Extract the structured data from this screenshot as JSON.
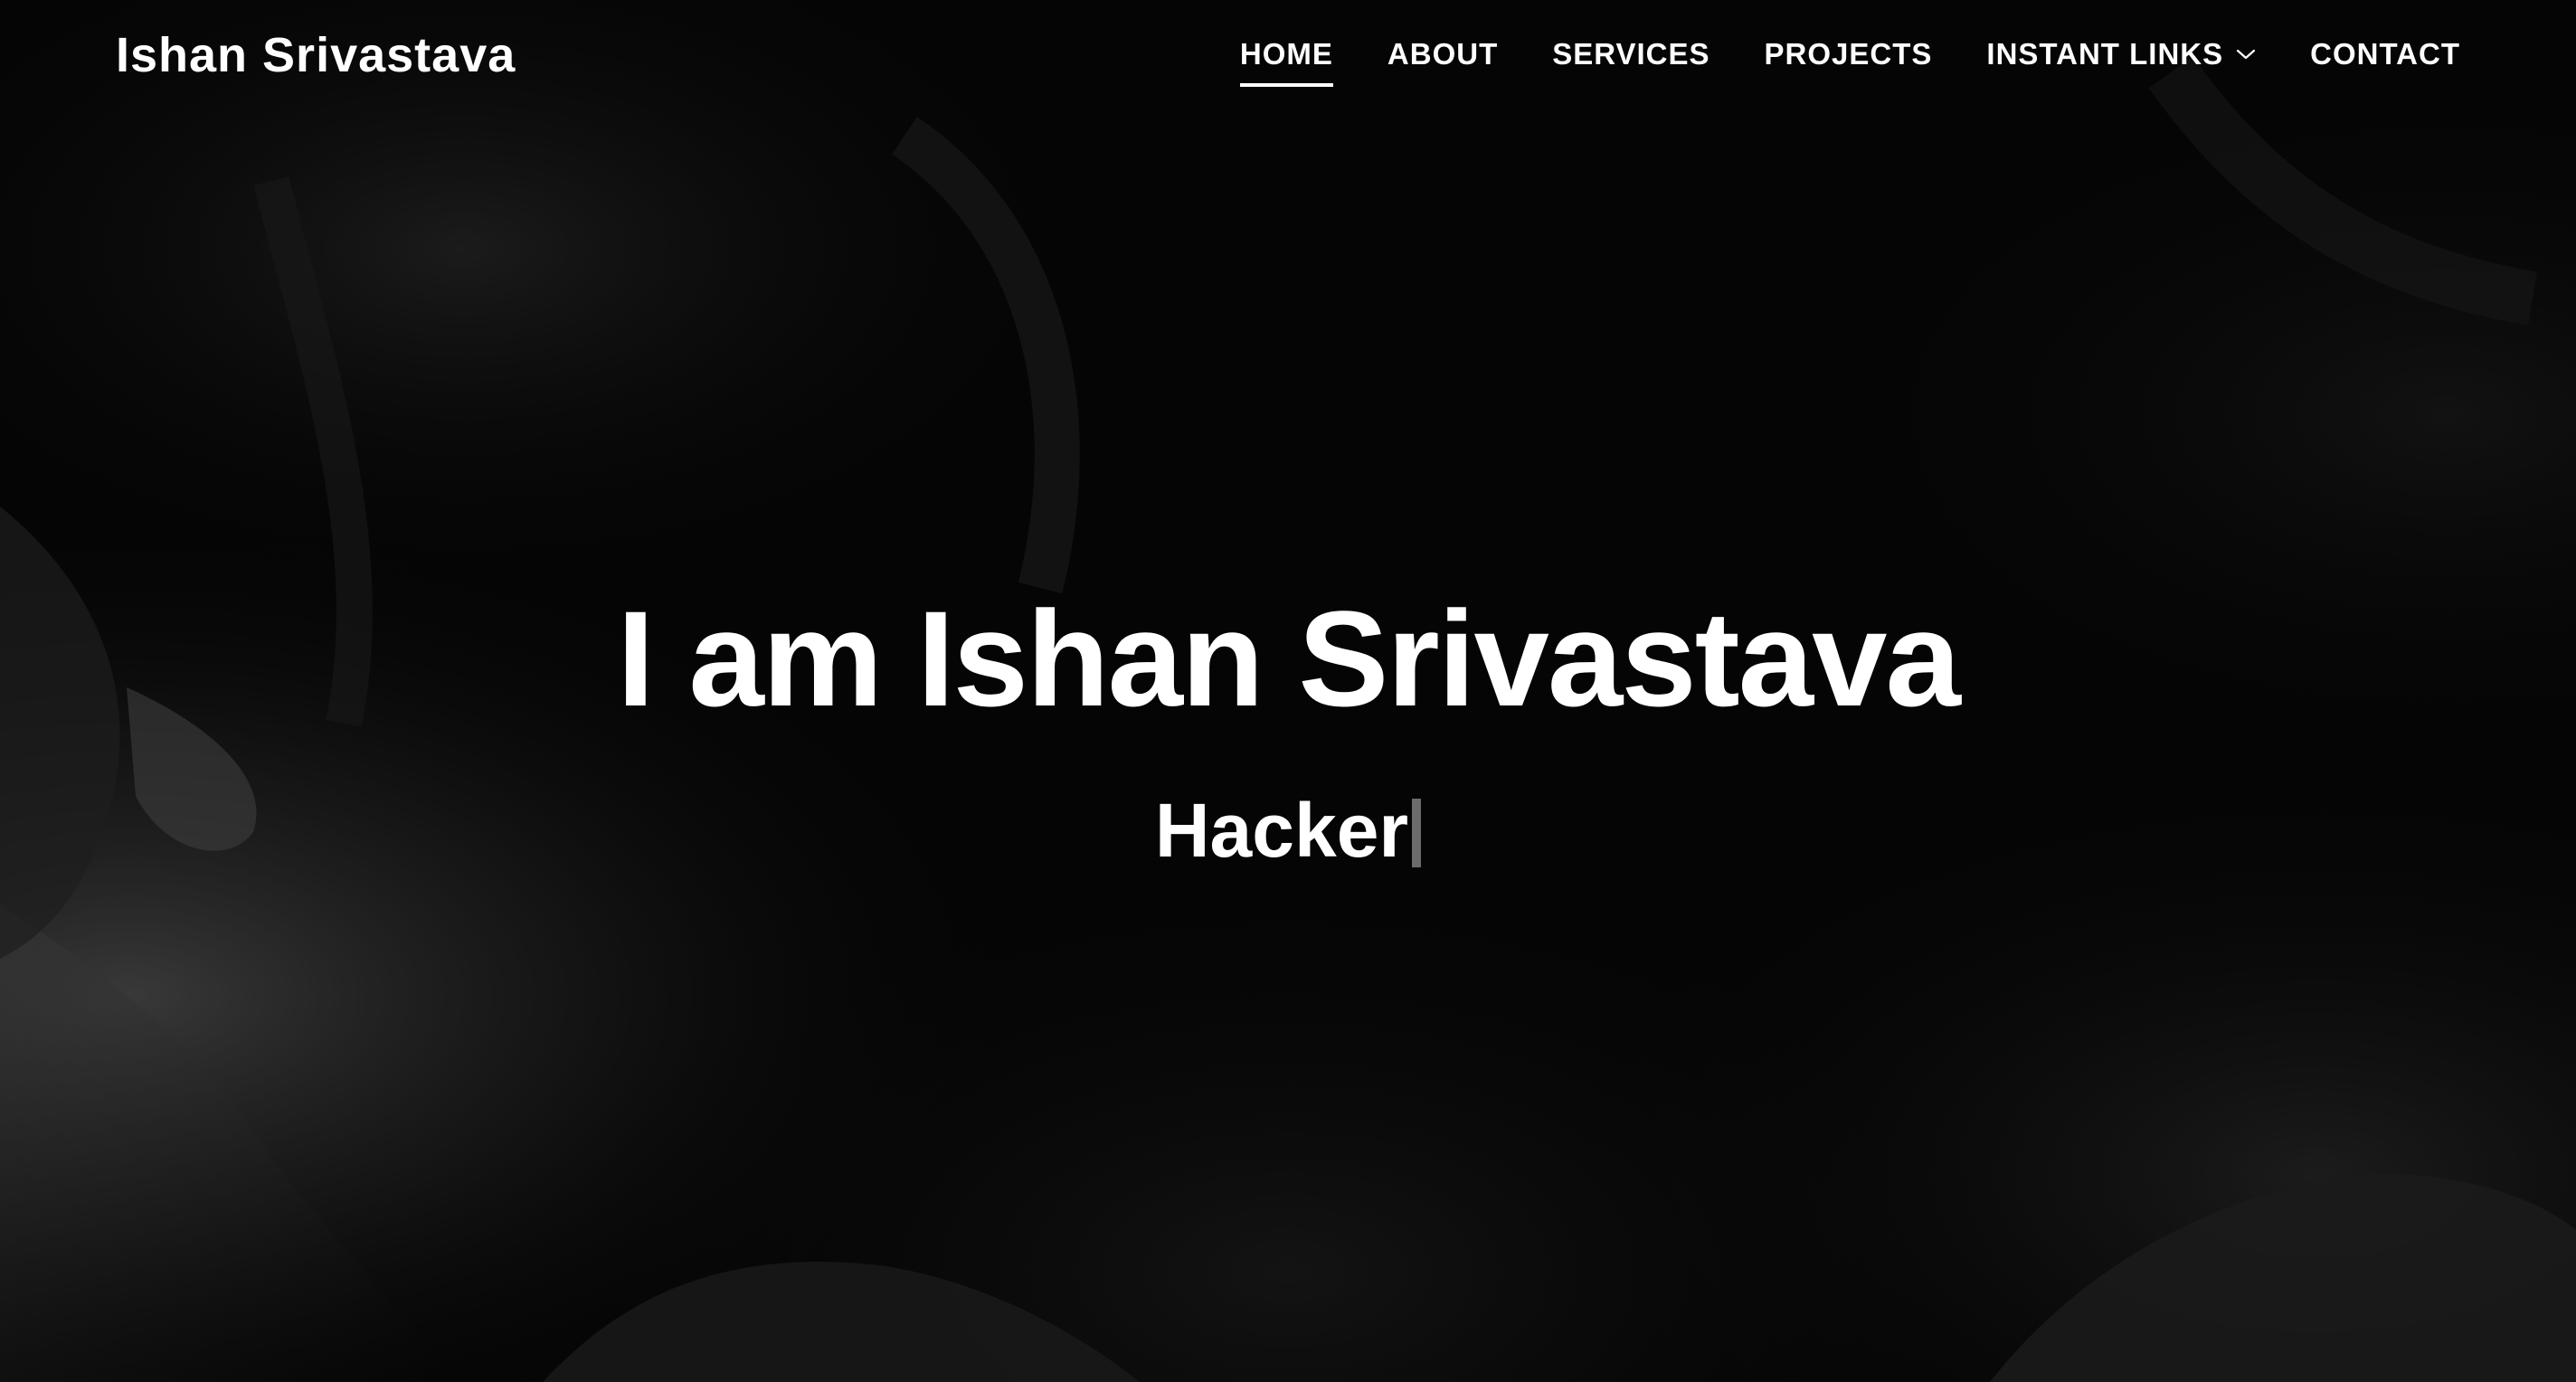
{
  "site": {
    "brand": "Ishan Srivastava"
  },
  "nav": {
    "items": [
      {
        "label": "HOME",
        "active": true
      },
      {
        "label": "ABOUT",
        "active": false
      },
      {
        "label": "SERVICES",
        "active": false
      },
      {
        "label": "PROJECTS",
        "active": false
      },
      {
        "label": "INSTANT LINKS",
        "active": false,
        "icon": "chevron-down-icon"
      },
      {
        "label": "CONTACT",
        "active": false
      }
    ]
  },
  "hero": {
    "title": "I am Ishan Srivastava",
    "typed_text": "Hacker",
    "cursor_icon": "text-cursor-icon"
  },
  "colors": {
    "background": "#050505",
    "text": "#ffffff",
    "cursor": "#6b6b6b"
  }
}
